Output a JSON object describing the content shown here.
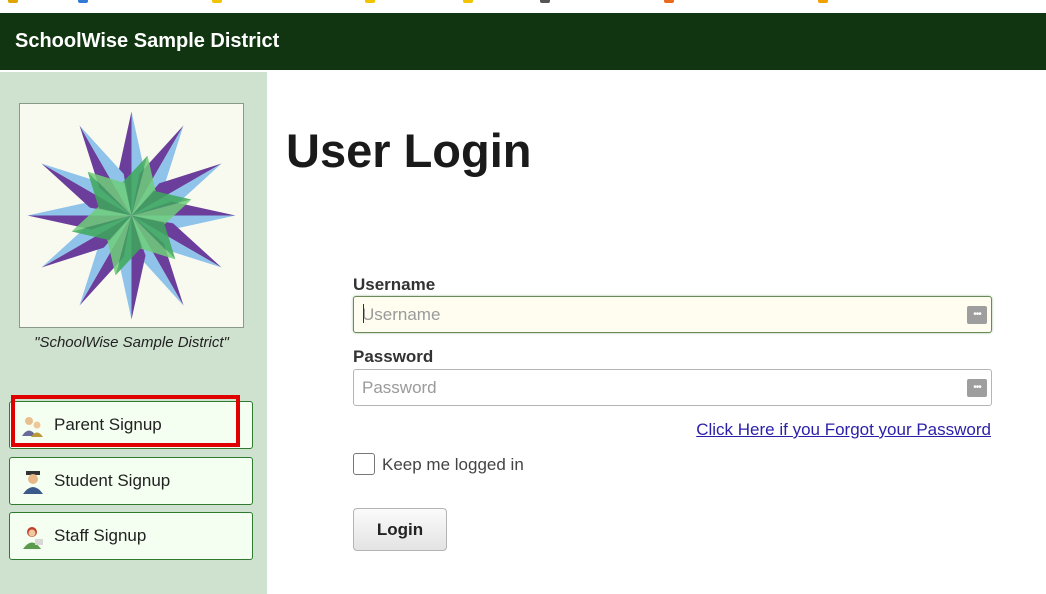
{
  "header": {
    "title": "SchoolWise Sample District"
  },
  "sidebar": {
    "logo_caption": "\"SchoolWise Sample District\"",
    "signups": [
      {
        "label": "Parent Signup",
        "icon": "parent-icon"
      },
      {
        "label": "Student Signup",
        "icon": "student-icon"
      },
      {
        "label": "Staff Signup",
        "icon": "staff-icon"
      }
    ]
  },
  "main": {
    "title": "User Login",
    "username": {
      "label": "Username",
      "placeholder": "Username",
      "value": ""
    },
    "password": {
      "label": "Password",
      "placeholder": "Password",
      "value": ""
    },
    "forgot_link": "Click Here if you Forgot your Password",
    "keep_logged_in": {
      "label": "Keep me logged in",
      "checked": false
    },
    "login_button": "Login",
    "password_manager_icon": "•••"
  },
  "colors": {
    "header_bg": "#103510",
    "sidebar_bg": "#cfe2cf",
    "highlight": "#e00000",
    "link": "#2a1fa8"
  }
}
